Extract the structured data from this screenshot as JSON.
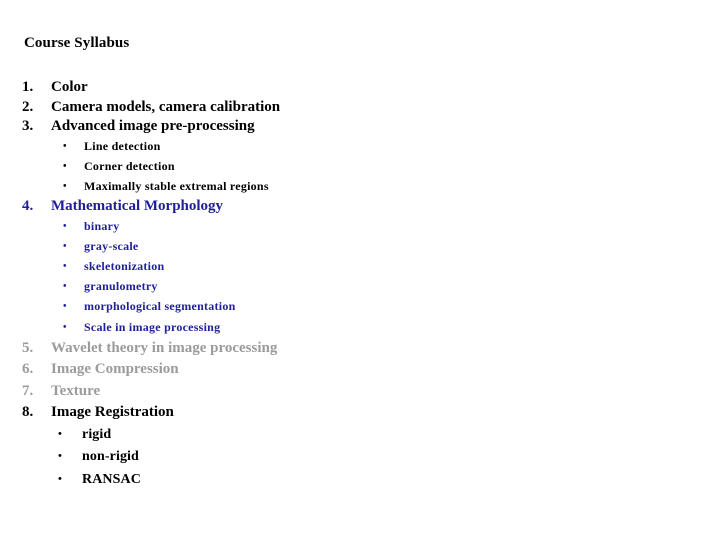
{
  "slide": {
    "title": "Course Syllabus",
    "background_color": "#ffffff",
    "colors": {
      "black": "#000000",
      "navy": "#1f1f99",
      "grey": "#9b9b9b"
    },
    "bullet_glyph": "•",
    "items": [
      {
        "number": "1.",
        "label": "Color",
        "color": "black",
        "subitems": []
      },
      {
        "number": "2.",
        "label": "Camera models, camera calibration",
        "color": "black",
        "subitems": []
      },
      {
        "number": "3.",
        "label": "Advanced image pre-processing",
        "color": "black",
        "subitems": [
          {
            "label": "Line detection",
            "color": "black"
          },
          {
            "label": "Corner detection",
            "color": "black"
          },
          {
            "label": "Maximally stable extremal regions",
            "color": "black"
          }
        ]
      },
      {
        "number": "4.",
        "label": "Mathematical Morphology",
        "color": "navy",
        "subitems": [
          {
            "label": "binary",
            "color": "navy"
          },
          {
            "label": "gray-scale",
            "color": "navy"
          },
          {
            "label": "skeletonization",
            "color": "navy"
          },
          {
            "label": "granulometry",
            "color": "navy"
          },
          {
            "label": "morphological segmentation",
            "color": "navy"
          },
          {
            "label": "Scale in image processing",
            "color": "navy"
          }
        ]
      },
      {
        "number": "5.",
        "label": "Wavelet theory in image processing",
        "color": "grey",
        "subitems": []
      },
      {
        "number": "6.",
        "label": "Image Compression",
        "color": "grey",
        "subitems": []
      },
      {
        "number": "7.",
        "label": "Texture",
        "color": "grey",
        "subitems": []
      },
      {
        "number": "8.",
        "label": "Image Registration",
        "color": "black",
        "subitems": [
          {
            "label": "rigid",
            "color": "black"
          },
          {
            "label": "non-rigid",
            "color": "black"
          },
          {
            "label": "RANSAC",
            "color": "black"
          }
        ]
      }
    ]
  }
}
